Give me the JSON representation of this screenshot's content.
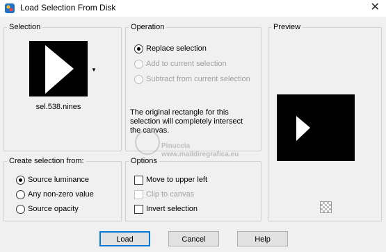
{
  "window": {
    "title": "Load Selection From Disk",
    "close_glyph": "✕"
  },
  "selection": {
    "label": "Selection",
    "file_name": "sel.538.nines",
    "dropdown_glyph": "▼"
  },
  "operation": {
    "label": "Operation",
    "options": [
      {
        "label": "Replace selection",
        "checked": true,
        "enabled": true
      },
      {
        "label": "Add to current selection",
        "checked": false,
        "enabled": false
      },
      {
        "label": "Subtract from current selection",
        "checked": false,
        "enabled": false
      }
    ],
    "note": "The original rectangle for this selection will completely intersect the canvas."
  },
  "preview": {
    "label": "Preview",
    "checker_icon": "checkerboard-icon"
  },
  "create_from": {
    "label": "Create selection from:",
    "options": [
      {
        "label": "Source luminance",
        "checked": true
      },
      {
        "label": "Any non-zero value",
        "checked": false
      },
      {
        "label": "Source opacity",
        "checked": false
      }
    ]
  },
  "options": {
    "label": "Options",
    "items": [
      {
        "label": "Move to upper left",
        "checked": false,
        "enabled": true
      },
      {
        "label": "Clip to canvas",
        "checked": false,
        "enabled": false
      },
      {
        "label": "Invert selection",
        "checked": false,
        "enabled": true
      }
    ]
  },
  "buttons": {
    "load": "Load",
    "cancel": "Cancel",
    "help": "Help"
  },
  "watermark": {
    "line1": "Pinuccia",
    "line2": "www.maildiregrafica.eu"
  },
  "colors": {
    "accent": "#0078d7",
    "dialog_bg": "#f0f0f0",
    "thumbnail_bg": "#000000"
  }
}
